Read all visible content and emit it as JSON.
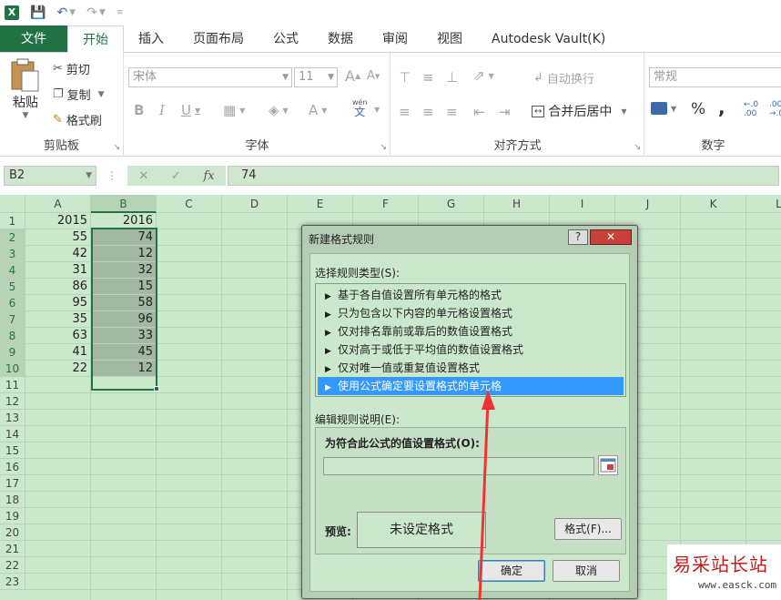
{
  "qat": {
    "undo_icon": "undo-icon",
    "redo_icon": "redo-icon"
  },
  "tabs": [
    "文件",
    "开始",
    "插入",
    "页面布局",
    "公式",
    "数据",
    "审阅",
    "视图",
    "Autodesk Vault(K)"
  ],
  "ribbon": {
    "clipboard": {
      "paste": "粘贴",
      "cut": "剪切",
      "copy": "复制",
      "format_painter": "格式刷",
      "label": "剪贴板"
    },
    "font": {
      "font_name": "宋体",
      "font_size": "11",
      "label": "字体",
      "bold": "B",
      "italic": "I",
      "underline": "U",
      "wen": "wén",
      "wen2": "文",
      "a_up": "A",
      "a_down": "A"
    },
    "alignment": {
      "wrap": "自动换行",
      "merge": "合并后居中",
      "label": "对齐方式"
    },
    "number": {
      "format": "常规",
      "percent": "%",
      "comma": ",",
      "label": "数字",
      "inc": "←.0\n.00",
      "dec": ".00\n→.0"
    }
  },
  "formula_bar": {
    "name_box": "B2",
    "value": "74",
    "fx": "fx",
    "cancel": "✕",
    "enter": "✓"
  },
  "columns": [
    "A",
    "B",
    "C",
    "D",
    "E",
    "F",
    "G",
    "H",
    "I",
    "J",
    "K",
    "L"
  ],
  "rows": [
    "1",
    "2",
    "3",
    "4",
    "5",
    "6",
    "7",
    "8",
    "9",
    "10",
    "11",
    "12",
    "13",
    "14",
    "15",
    "16",
    "17",
    "18",
    "19",
    "20",
    "21",
    "22",
    "23"
  ],
  "cells": {
    "A": [
      "2015",
      "55",
      "42",
      "31",
      "86",
      "95",
      "35",
      "63",
      "41",
      "22"
    ],
    "B": [
      "2016",
      "74",
      "12",
      "32",
      "15",
      "58",
      "96",
      "33",
      "45",
      "12"
    ]
  },
  "dialog": {
    "title": "新建格式规则",
    "help": "?",
    "close": "✕",
    "select_type_label": "选择规则类型(S):",
    "rule_types": [
      "基于各自值设置所有单元格的格式",
      "只为包含以下内容的单元格设置格式",
      "仅对排名靠前或靠后的数值设置格式",
      "仅对高于或低于平均值的数值设置格式",
      "仅对唯一值或重复值设置格式",
      "使用公式确定要设置格式的单元格"
    ],
    "edit_desc_label": "编辑规则说明(E):",
    "formula_label": "为符合此公式的值设置格式(O):",
    "formula_value": "",
    "preview_label": "预览:",
    "preview_text": "未设定格式",
    "format_button": "格式(F)...",
    "ok": "确定",
    "cancel": "取消"
  },
  "watermark": {
    "title": "易采站长站",
    "url": "www.easck.com"
  }
}
